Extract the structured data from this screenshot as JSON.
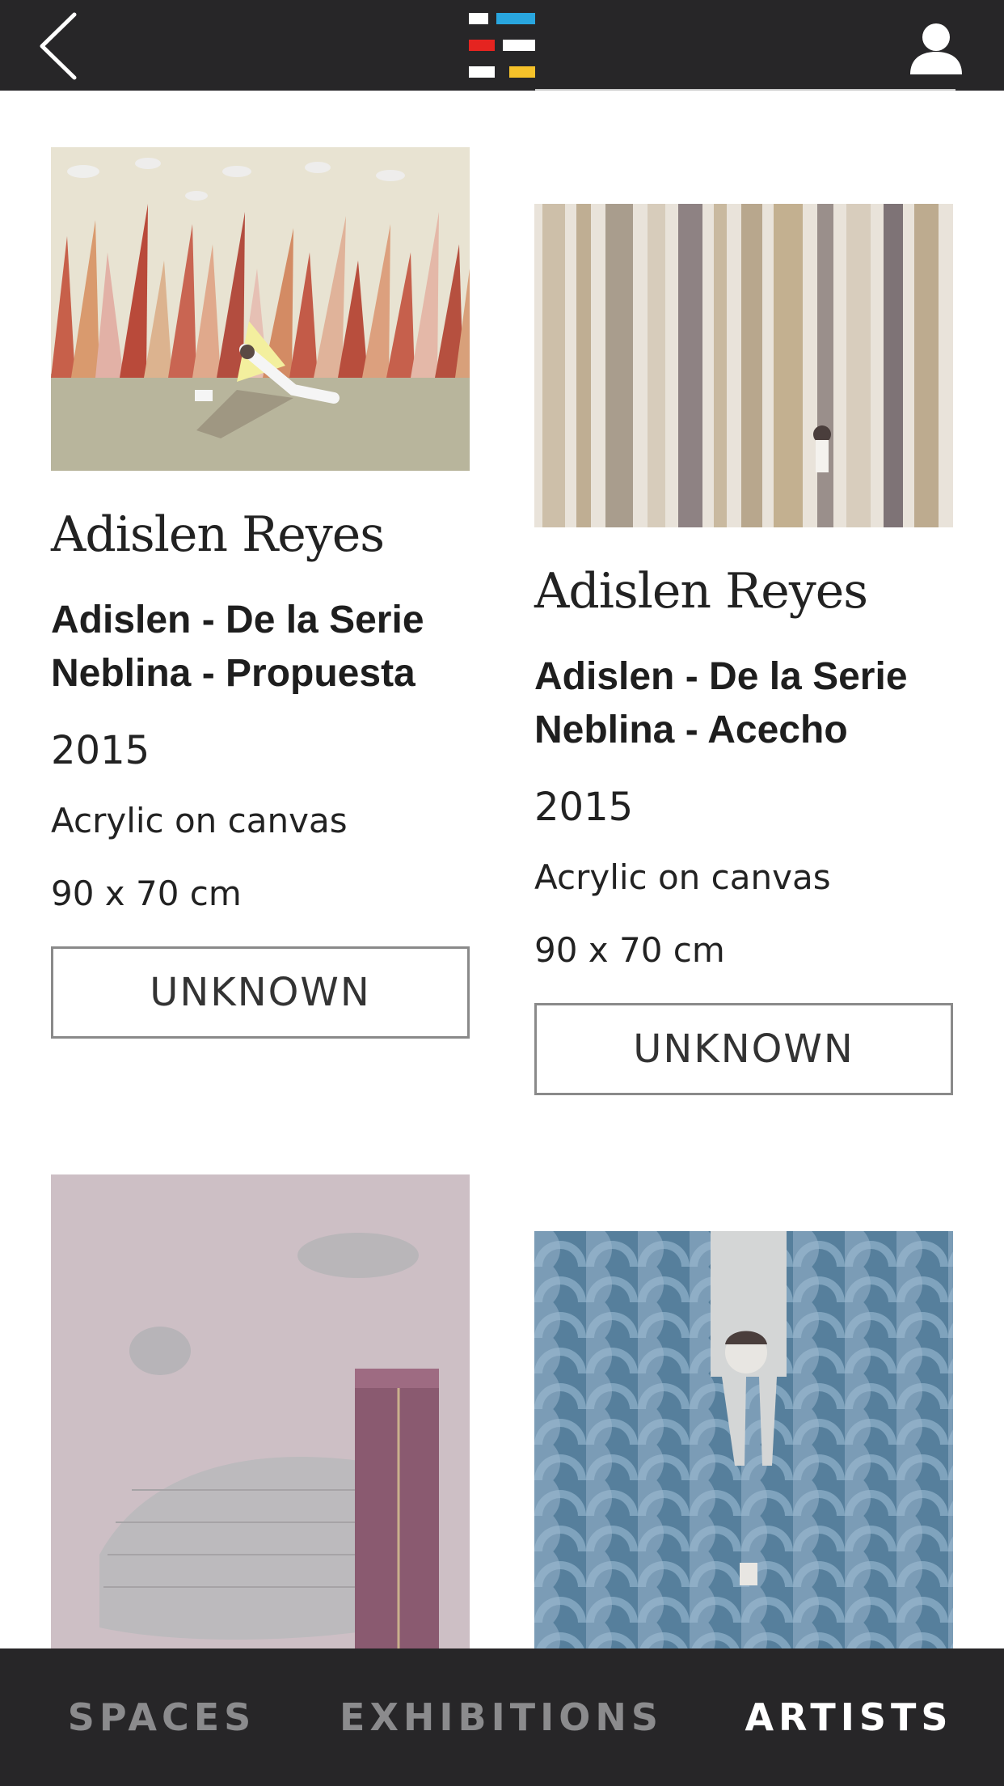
{
  "header": {
    "back_icon": "chevron-left-icon",
    "logo_icon": "app-logo-icon",
    "profile_icon": "user-icon",
    "logo_colors": [
      "#ffffff",
      "#29a6df",
      "#e52420",
      "#ffffff",
      "#ffffff",
      "#f6c22a"
    ]
  },
  "artworks": [
    {
      "artist": "Adislen Reyes",
      "title": "Adislen - De la Serie Neblina - Propuesta",
      "year": "2015",
      "medium": "Acrylic on canvas",
      "dimensions": "90 x 70 cm",
      "status": "UNKNOWN"
    },
    {
      "artist": "Adislen Reyes",
      "title": "Adislen - De la Serie Neblina - Acecho",
      "year": "2015",
      "medium": "Acrylic on canvas",
      "dimensions": "90 x 70 cm",
      "status": "UNKNOWN"
    },
    {},
    {}
  ],
  "tabs": [
    {
      "label": "SPACES",
      "active": false
    },
    {
      "label": "EXHIBITIONS",
      "active": false
    },
    {
      "label": "ARTISTS",
      "active": true
    }
  ]
}
